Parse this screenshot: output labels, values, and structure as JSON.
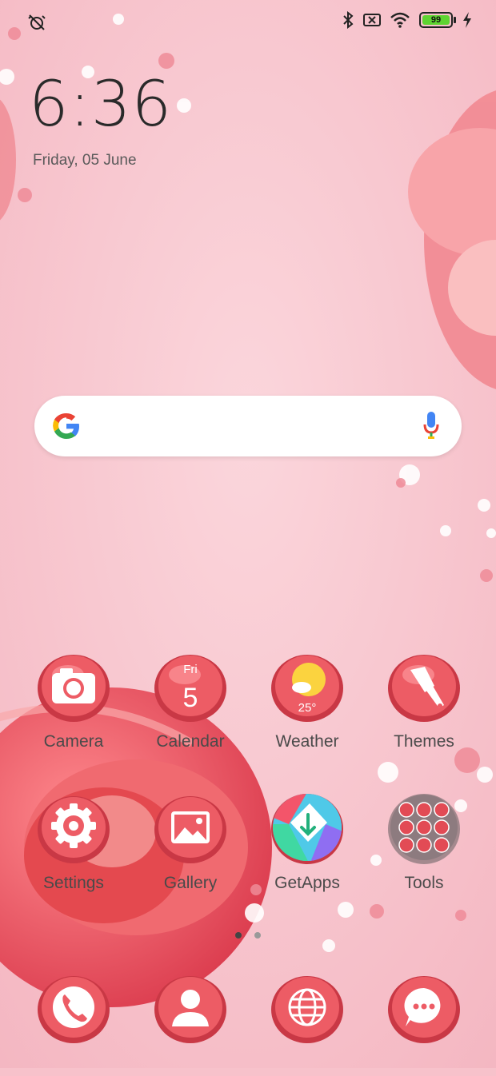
{
  "status_bar": {
    "left_icons": [
      "alarm-off-icon"
    ],
    "right_icons": [
      "bluetooth-icon",
      "no-sim-icon",
      "wifi-icon",
      "battery-icon",
      "charging-icon"
    ],
    "battery_level": "99"
  },
  "clock": {
    "time": "6:36",
    "date": "Friday, 05 June"
  },
  "search": {
    "placeholder": ""
  },
  "apps_row1": [
    {
      "label": "Camera",
      "icon": "camera-icon"
    },
    {
      "label": "Calendar",
      "icon": "calendar-icon",
      "day": "Fri",
      "date": "5"
    },
    {
      "label": "Weather",
      "icon": "weather-icon",
      "temp": "25°"
    },
    {
      "label": "Themes",
      "icon": "paintbrush-icon"
    }
  ],
  "apps_row2": [
    {
      "label": "Settings",
      "icon": "gear-icon"
    },
    {
      "label": "Gallery",
      "icon": "image-icon"
    },
    {
      "label": "GetApps",
      "icon": "getapps-icon"
    },
    {
      "label": "Tools",
      "icon": "folder-icon"
    }
  ],
  "page_indicator": {
    "pages": 2,
    "active": 0
  },
  "dock": [
    {
      "icon": "phone-icon"
    },
    {
      "icon": "contacts-icon"
    },
    {
      "icon": "browser-icon"
    },
    {
      "icon": "messages-icon"
    }
  ],
  "colors": {
    "wallpaper": "#f7c2cb",
    "icon_red": "#e24b55",
    "accent": "#5ed431"
  }
}
